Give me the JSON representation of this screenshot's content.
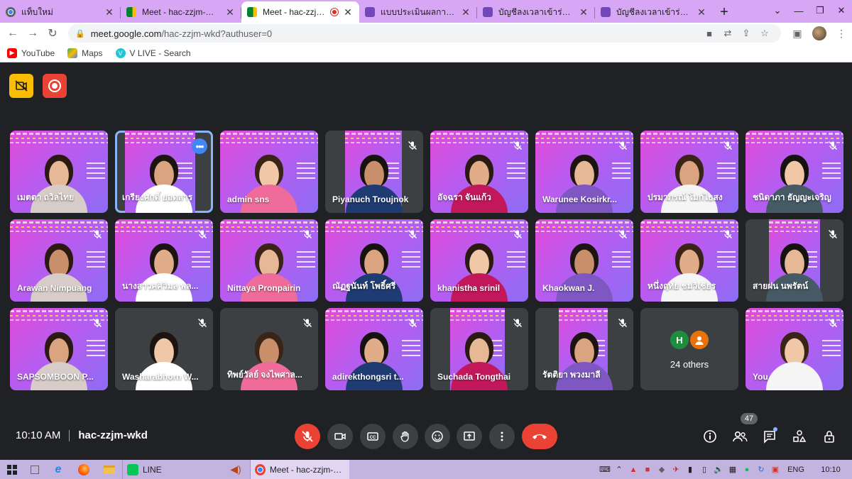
{
  "browser": {
    "tabs": [
      {
        "label": "แท็บใหม่",
        "icon": "chrome-icon",
        "color": "#5f6368",
        "active": false
      },
      {
        "label": "Meet - hac-zzjm-wkd",
        "icon": "meet-icon",
        "color": "#00ac47",
        "active": false
      },
      {
        "label": "Meet - hac-zzjm-w",
        "icon": "meet-icon",
        "color": "#00ac47",
        "active": true
      },
      {
        "label": "แบบประเมินผลการจัดกิจกร",
        "icon": "forms-icon",
        "color": "#7248b9",
        "active": false
      },
      {
        "label": "บัญชีลงเวลาเข้าร่วมกิจกรร",
        "icon": "forms-icon",
        "color": "#7248b9",
        "active": false
      },
      {
        "label": "บัญชีลงเวลาเข้าร่วมกิจกรร",
        "icon": "forms-icon",
        "color": "#7248b9",
        "active": false
      }
    ],
    "url_host": "meet.google.com",
    "url_path": "/hac-zzjm-wkd?authuser=0",
    "bookmarks": [
      {
        "label": "YouTube",
        "icon": "youtube-icon",
        "color": "#ff0000"
      },
      {
        "label": "Maps",
        "icon": "maps-icon",
        "color": "#34a853"
      },
      {
        "label": "V LIVE - Search",
        "icon": "vlive-icon",
        "color": "#1ec6d6"
      }
    ]
  },
  "meet": {
    "participants": [
      {
        "name": "เมตตา ถวิลไทย",
        "muted": false,
        "speaking": false
      },
      {
        "name": "เกรียงศักดิ์ ยอดสาร",
        "muted": false,
        "speaking": true
      },
      {
        "name": "admin sns",
        "muted": false,
        "speaking": false
      },
      {
        "name": "Piyanuch Troujnok",
        "muted": true,
        "speaking": false
      },
      {
        "name": "อัจฉรา จันแก้ว",
        "muted": true,
        "speaking": false
      },
      {
        "name": "Warunee Kosirkr...",
        "muted": true,
        "speaking": false
      },
      {
        "name": "ปรมาภรณ์ โมกไธสง",
        "muted": true,
        "speaking": false
      },
      {
        "name": "ชนิดาภา ธัญญะเจริญ",
        "muted": true,
        "speaking": false
      },
      {
        "name": "Arawan Nimpuang",
        "muted": true,
        "speaking": false
      },
      {
        "name": "นางสาวศศิวิมล พล...",
        "muted": true,
        "speaking": false
      },
      {
        "name": "Nittaya Pronpairin",
        "muted": true,
        "speaking": false
      },
      {
        "name": "ณัฏฐนันท์ โพธิ์ศรี",
        "muted": true,
        "speaking": false
      },
      {
        "name": "khanistha srinil",
        "muted": true,
        "speaking": false
      },
      {
        "name": "Khaokwan J.",
        "muted": true,
        "speaking": false
      },
      {
        "name": "หนึ่งฤทัย ชมวิเชียร",
        "muted": true,
        "speaking": false
      },
      {
        "name": "สายฝน นพรัตน์",
        "muted": true,
        "speaking": false
      },
      {
        "name": "SAPSOMBOON P...",
        "muted": true,
        "speaking": false
      },
      {
        "name": "Washarabhorn W...",
        "muted": true,
        "speaking": false
      },
      {
        "name": "ทิพย์วัลย์ จงไพศาล...",
        "muted": true,
        "speaking": false
      },
      {
        "name": "adirekthongsri t...",
        "muted": true,
        "speaking": false
      },
      {
        "name": "Suchada Tongthai",
        "muted": true,
        "speaking": false
      },
      {
        "name": "รัตติยา พวงมาลี",
        "muted": true,
        "speaking": false
      },
      {
        "name": "You",
        "muted": true,
        "speaking": false
      }
    ],
    "others": {
      "label": "24 others",
      "chips": [
        "H",
        ""
      ]
    },
    "time": "10:10 AM",
    "meeting_code": "hac-zzjm-wkd",
    "participant_count": "47",
    "more_options_glyph": "•••"
  },
  "taskbar": {
    "apps": [
      {
        "label": "LINE",
        "icon": "line-icon",
        "color": "#06c755"
      },
      {
        "label": "Meet - hac-zzjm-wk...",
        "icon": "chrome-icon",
        "color": "#4285f4"
      }
    ],
    "language": "ENG",
    "clock": "10:10"
  }
}
